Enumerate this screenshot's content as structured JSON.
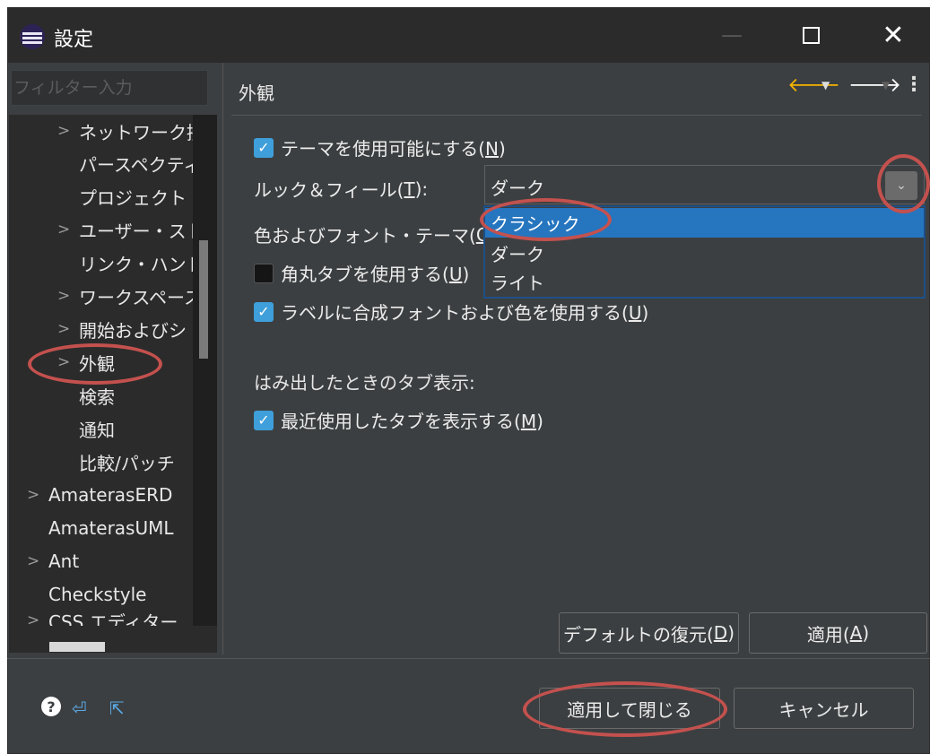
{
  "window": {
    "title": "設定",
    "icon": "eclipse-icon"
  },
  "window_controls": {
    "minimize": "—",
    "close": "✕"
  },
  "sidebar": {
    "filter_placeholder": "フィルター入力",
    "items": [
      {
        "label": "ネットワーク接",
        "expandable": true
      },
      {
        "label": "パースペクティ",
        "expandable": false
      },
      {
        "label": "プロジェクト・",
        "expandable": false
      },
      {
        "label": "ユーザー・スト",
        "expandable": true
      },
      {
        "label": "リンク・ハンド",
        "expandable": false
      },
      {
        "label": "ワークスペース",
        "expandable": true
      },
      {
        "label": "開始およびシ",
        "expandable": true
      },
      {
        "label": "外観",
        "expandable": true
      },
      {
        "label": "検索",
        "expandable": false
      },
      {
        "label": "通知",
        "expandable": false
      },
      {
        "label": "比較/パッチ",
        "expandable": false
      },
      {
        "label": "AmaterasERD",
        "expandable": true
      },
      {
        "label": "AmaterasUML",
        "expandable": false
      },
      {
        "label": "Ant",
        "expandable": true
      },
      {
        "label": "Checkstyle",
        "expandable": false
      },
      {
        "label": "CSS エディター",
        "expandable": true
      }
    ]
  },
  "page": {
    "title": "外観",
    "nav_icons": {
      "back": "🡐",
      "dropdown": "▼",
      "forward": "🡒",
      "menu": "⋮"
    },
    "enable_theme": {
      "label": "テーマを使用可能にする(",
      "mnemonic": "N",
      "suffix": ")",
      "checked": true
    },
    "look_and_feel": {
      "label": "ルック＆フィール(",
      "mnemonic": "T",
      "suffix": "):",
      "value": "ダーク",
      "options": [
        "クラシック",
        "ダーク",
        "ライト"
      ],
      "highlighted": "クラシック"
    },
    "color_font_theme": {
      "label": "色およびフォント・テーマ(",
      "mnemonic": "C",
      "suffix": "):"
    },
    "rounded_tabs": {
      "label": "角丸タブを使用する(",
      "mnemonic": "U",
      "suffix": ")",
      "checked": false
    },
    "mixed_fonts": {
      "label": "ラベルに合成フォントおよび色を使用する(",
      "mnemonic": "U",
      "suffix": ")",
      "checked": true
    },
    "tab_overflow_label": "はみ出したときのタブ表示:",
    "recent_tabs": {
      "label": "最近使用したタブを表示する(",
      "mnemonic": "M",
      "suffix": ")",
      "checked": true
    },
    "restore_defaults": {
      "label": "デフォルトの復元(",
      "mnemonic": "D",
      "suffix": ")"
    },
    "apply": {
      "label": "適用(",
      "mnemonic": "A",
      "suffix": ")"
    }
  },
  "footer": {
    "apply_and_close": "適用して閉じる",
    "cancel": "キャンセル",
    "icons": [
      "help-icon",
      "import-icon",
      "export-icon"
    ]
  },
  "annotation_color": "#c4514e"
}
